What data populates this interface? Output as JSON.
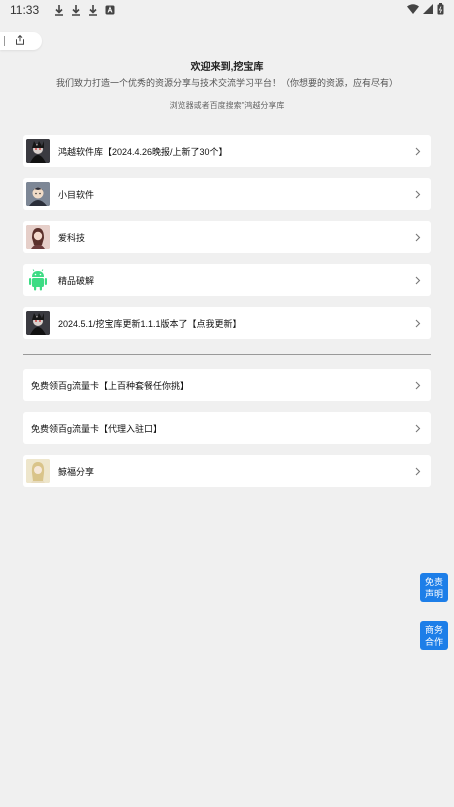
{
  "status_bar": {
    "time": "11:33"
  },
  "header": {
    "title": "欢迎来到,挖宝库",
    "description": "我们致力打造一个优秀的资源分享与技术交流学习平台！（你想要的资源，应有尽有）",
    "hint": "浏览器或者百度搜索\"鸿越分享库"
  },
  "items": [
    {
      "label": "鸿越软件库【2024.4.26晚报/上新了30个】",
      "icon": "dark-anime-avatar-icon"
    },
    {
      "label": "小目软件",
      "icon": "anime-boy-avatar-icon"
    },
    {
      "label": "爱科技",
      "icon": "girl-portrait-avatar-icon"
    },
    {
      "label": "精品破解",
      "icon": "android-robot-icon"
    },
    {
      "label": "2024.5.1/挖宝库更新1.1.1版本了【点我更新】",
      "icon": "dark-anime-avatar-icon"
    }
  ],
  "items2": [
    {
      "label": "免费领百g流量卡【上百种套餐任你挑】"
    },
    {
      "label": "免费领百g流量卡【代理入驻口】"
    },
    {
      "label": "鲸福分享",
      "icon": "blonde-girl-avatar-icon"
    }
  ],
  "float_buttons": {
    "disclaimer": "免责声明",
    "business": "商务合作"
  },
  "colors": {
    "background": "#f0f0f0",
    "accent": "#1d7ee8",
    "card": "#ffffff"
  }
}
